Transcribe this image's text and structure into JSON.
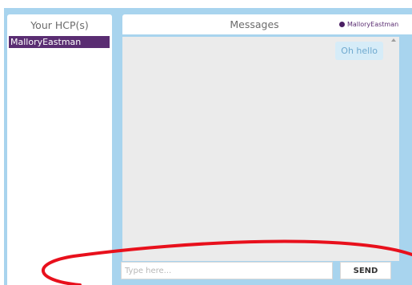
{
  "sidebar": {
    "title": "Your HCP(s)",
    "items": [
      {
        "label": "MalloryEastman",
        "selected": true
      }
    ]
  },
  "messages": {
    "title": "Messages",
    "online_user": "MalloryEastman",
    "thread": [
      {
        "text": "Oh hello",
        "from": "self"
      }
    ]
  },
  "composer": {
    "placeholder": "Type here...",
    "value": "",
    "send_label": "SEND"
  },
  "colors": {
    "frame": "#a8d4ee",
    "selected_item": "#5a2d72",
    "bubble": "#d6ecf8",
    "annotation": "#e8101c"
  },
  "icons": {
    "status": "online-dot-icon",
    "scroll": "scroll-up-arrow-icon"
  }
}
